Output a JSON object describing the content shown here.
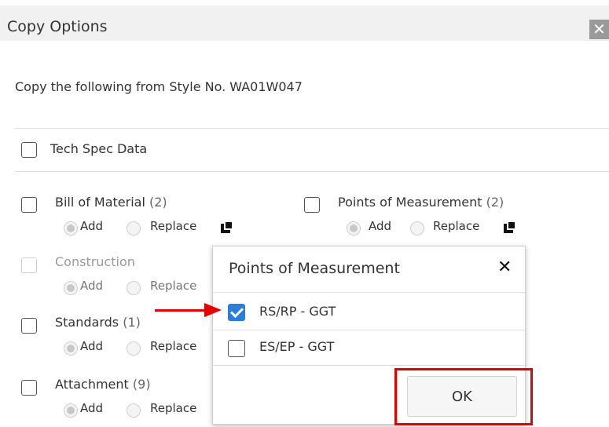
{
  "dialog": {
    "title": "Copy Options",
    "close_glyph": "✕",
    "intro": "Copy the following from Style No. WA01W047"
  },
  "options": {
    "tech_spec": {
      "label": "Tech Spec Data",
      "checked": false
    },
    "bom": {
      "label": "Bill of Material",
      "count": "(2)",
      "add": "Add",
      "replace": "Replace"
    },
    "pom": {
      "label": "Points of Measurement",
      "count": "(2)",
      "add": "Add",
      "replace": "Replace"
    },
    "construction": {
      "label": "Construction",
      "add": "Add",
      "replace": "Replace",
      "disabled": true
    },
    "standards": {
      "label": "Standards",
      "count": "(1)",
      "add": "Add",
      "replace": "Replace"
    },
    "attachment": {
      "label": "Attachment",
      "count": "(9)",
      "add": "Add",
      "replace": "Replace"
    }
  },
  "popup": {
    "title": "Points of Measurement",
    "close_glyph": "✕",
    "items": [
      {
        "label": "RS/RP - GGT",
        "checked": true
      },
      {
        "label": "ES/EP - GGT",
        "checked": false
      }
    ],
    "ok_label": "OK"
  },
  "colors": {
    "accent_checkbox": "#2b7ed8",
    "annotation_red": "#e20000",
    "titlebar_bg": "#f1f1f1"
  },
  "icons": {
    "copy_detail": "copy-icon",
    "close": "close-icon"
  }
}
